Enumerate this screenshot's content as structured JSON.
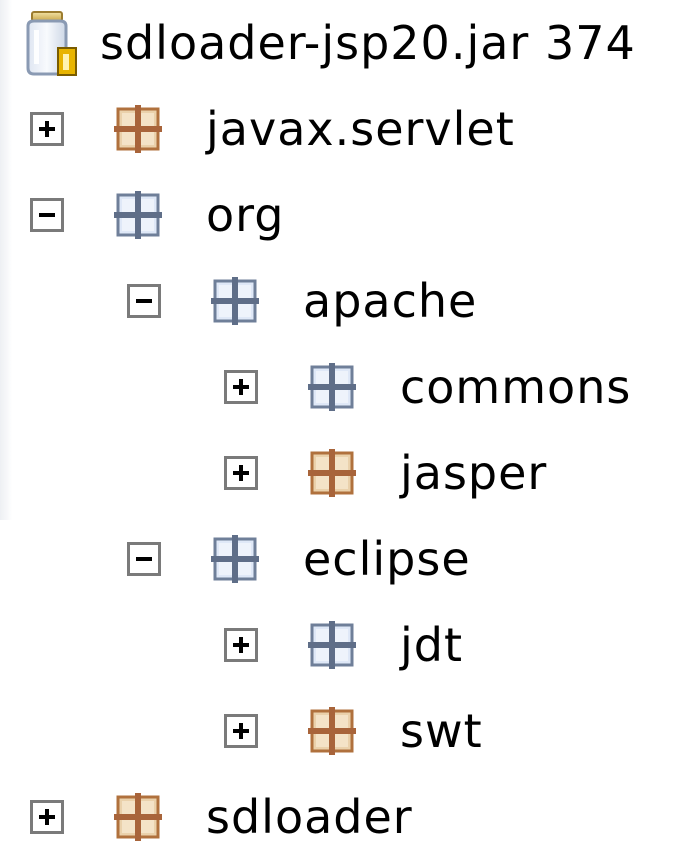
{
  "tree": {
    "root": {
      "label": "sdloader-jsp20.jar 374",
      "icon": "jar-icon"
    },
    "nodes": [
      {
        "label": "javax.servlet",
        "depth": 0,
        "expanded": false,
        "icon": "package-orange"
      },
      {
        "label": "org",
        "depth": 0,
        "expanded": true,
        "icon": "package-blue"
      },
      {
        "label": "apache",
        "depth": 1,
        "expanded": true,
        "icon": "package-blue"
      },
      {
        "label": "commons",
        "depth": 2,
        "expanded": false,
        "icon": "package-blue"
      },
      {
        "label": "jasper",
        "depth": 2,
        "expanded": false,
        "icon": "package-orange"
      },
      {
        "label": "eclipse",
        "depth": 1,
        "expanded": true,
        "icon": "package-blue"
      },
      {
        "label": "jdt",
        "depth": 2,
        "expanded": false,
        "icon": "package-blue"
      },
      {
        "label": "swt",
        "depth": 2,
        "expanded": false,
        "icon": "package-orange"
      },
      {
        "label": "sdloader",
        "depth": 0,
        "expanded": false,
        "icon": "package-orange"
      }
    ]
  },
  "colors": {
    "background": "#ffffff",
    "text": "#000000",
    "toggle_border": "#7a7a7a",
    "package_blue_fill": "#dfe8f7",
    "package_blue_frame": "#6f7f99",
    "package_orange_fill": "#ead1ab",
    "package_orange_frame": "#b0713d"
  }
}
